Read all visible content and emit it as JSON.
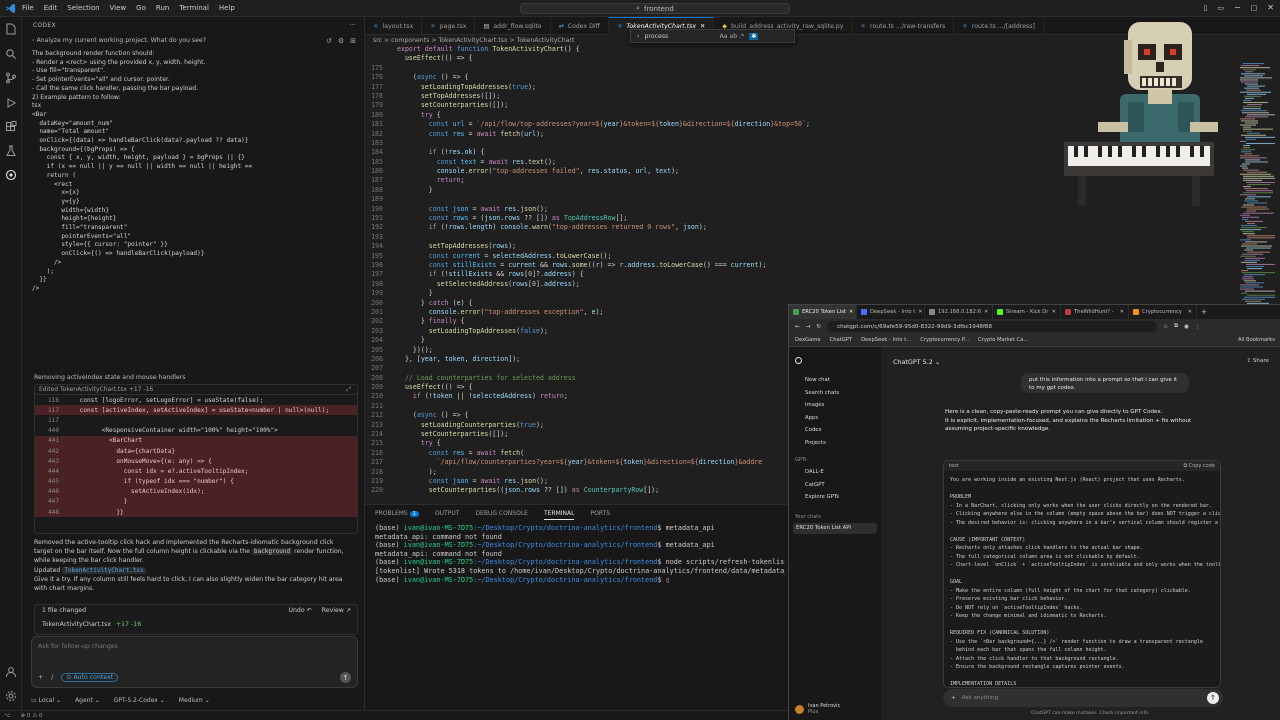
{
  "menu": [
    "File",
    "Edit",
    "Selection",
    "View",
    "Go",
    "Run",
    "Terminal",
    "Help"
  ],
  "command_center": "frontend",
  "codex": {
    "title": "CODEX",
    "prompt_header": "Analyze my current working project. What do you see?",
    "msg_lines": [
      "The background render function should:",
      "- Render a <rect> using the provided x, y, width, height.",
      "- Use fill=\"transparent\".",
      "- Set pointerEvents=\"all\" and cursor: pointer.",
      "- Call the same click handler, passing the bar payload.",
      "",
      "2) Example pattern to follow:",
      "tsx",
      "<Bar",
      "  dataKey=\"amount_num\"",
      "  name=\"Total amount\"",
      "  onClick={(data) => handleBarClick(data?.payload ?? data)}",
      "  background={(bgProps) => {",
      "    const { x, y, width, height, payload } = bgProps || {}",
      "    if (x == null || y == null || width == null || height ==",
      "",
      "    return (",
      "      <rect",
      "        x={x}",
      "        y={y}",
      "        width={width}",
      "        height={height}",
      "        fill=\"transparent\"",
      "        pointerEvents=\"all\"",
      "        style={{ cursor: \"pointer\" }}",
      "        onClick={() => handleBarClick(payload)}",
      "      />",
      "    );",
      "  }}",
      "/>"
    ],
    "removing": "Removing activeIndex state and mouse handlers",
    "diff_header": "Edited TokenActivityChart.tsx +17 -16",
    "diff": [
      {
        "n": "116",
        "t": "    const [logoError, setLogoError] = useState(false);",
        "k": "ctx"
      },
      {
        "n": "117",
        "t": "    const [activeIndex, setActiveIndex] = useState<number | null>(null);",
        "k": "del"
      },
      {
        "n": "117",
        "t": "",
        "k": "ctx"
      },
      {
        "n": "440",
        "t": "          <ResponsiveContainer width=\"100%\" height=\"100%\">",
        "k": "ctx"
      },
      {
        "n": "441",
        "t": "            <BarChart",
        "k": "del"
      },
      {
        "n": "442",
        "t": "              data={chartData}",
        "k": "del"
      },
      {
        "n": "443",
        "t": "              onMouseMove={(e: any) => {",
        "k": "del"
      },
      {
        "n": "444",
        "t": "                const idx = e?.activeTooltipIndex;",
        "k": "del"
      },
      {
        "n": "445",
        "t": "                if (typeof idx === \"number\") {",
        "k": "del"
      },
      {
        "n": "446",
        "t": "                  setActiveIndex(idx);",
        "k": "del"
      },
      {
        "n": "447",
        "t": "                }",
        "k": "del"
      },
      {
        "n": "448",
        "t": "              }}",
        "k": "del"
      },
      {
        "n": "",
        "t": "",
        "k": "ctx"
      }
    ],
    "summary_1": "Removed the active-tooltip click hack and implemented the Recharts-idiomatic background click target on the bar itself. Now the full column height is clickable via the",
    "summary_code": "background",
    "summary_2": "render function, while keeping the bar click handler.",
    "summary_updated": "Updated",
    "summary_file": "TokenActivityChart.tsx",
    "summary_3": "Give it a try. If any column still feels hard to click, I can also slightly widen the bar category hit area with chart margins.",
    "files_changed": "1 file changed",
    "undo": "Undo",
    "review": "Review",
    "changed_file": "TokenActivityChart.tsx",
    "changed_stats": "+17 -16",
    "followup_placeholder": "Ask for follow-up changes",
    "auto_context": "Auto context",
    "footer": [
      "Local",
      "Agent",
      "GPT-5.2-Codex",
      "Medium"
    ]
  },
  "editor": {
    "tabs": [
      "layout.tsx",
      "page.tsx",
      "addr_flow.sqlite",
      "Codex Diff",
      "TokenActivityChart.tsx",
      "build_address_activity_raw_sqlite.py",
      "route.ts .../raw-transfers",
      "route.ts .../[address]"
    ],
    "active_tab": 4,
    "breadcrumb": "src > components > TokenActivityChart.tsx > TokenActivityChart",
    "find_value": "process",
    "find_opts": "Aa  ab  .*"
  },
  "code_lines": [
    {
      "n": "",
      "h": "<span class=\"kw\">export default</span> <span class=\"kb\">function</span> <span class=\"fn\">TokenActivityChart</span>() {"
    },
    {
      "n": "",
      "h": "  <span class=\"fn\">useEffect</span>(() =&gt; {"
    },
    {
      "n": "175",
      "h": ""
    },
    {
      "n": "176",
      "h": "    (<span class=\"kb\">async</span> () =&gt; {"
    },
    {
      "n": "177",
      "h": "      <span class=\"fn\">setLoadingTopAddresses</span>(<span class=\"kb\">true</span>);"
    },
    {
      "n": "178",
      "h": "      <span class=\"fn\">setTopAddresses</span>([]);"
    },
    {
      "n": "179",
      "h": "      <span class=\"fn\">setCounterparties</span>([]);"
    },
    {
      "n": "180",
      "h": "      <span class=\"kw\">try</span> {"
    },
    {
      "n": "181",
      "h": "        <span class=\"kb\">const</span> <span class=\"bl\">url</span> = <span class=\"st\">`/api/flow/top-addresses?year=${</span><span class=\"vr\">year</span><span class=\"st\">}&amp;token=${</span><span class=\"vr\">token</span><span class=\"st\">}&amp;direction=${</span><span class=\"vr\">direction</span><span class=\"st\">}&amp;top=50`</span>;"
    },
    {
      "n": "182",
      "h": "        <span class=\"kb\">const</span> <span class=\"bl\">res</span> = <span class=\"kw\">await</span> <span class=\"fn\">fetch</span>(<span class=\"vr\">url</span>);"
    },
    {
      "n": "183",
      "h": ""
    },
    {
      "n": "184",
      "h": "        <span class=\"kw\">if</span> (!<span class=\"vr\">res</span>.<span class=\"vr\">ok</span>) {"
    },
    {
      "n": "185",
      "h": "          <span class=\"kb\">const</span> <span class=\"bl\">text</span> = <span class=\"kw\">await</span> <span class=\"vr\">res</span>.<span class=\"fn\">text</span>();"
    },
    {
      "n": "186",
      "h": "          <span class=\"vr\">console</span>.<span class=\"fn\">error</span>(<span class=\"st\">\"top-addresses failed\"</span>, <span class=\"vr\">res</span>.<span class=\"vr\">status</span>, <span class=\"vr\">url</span>, <span class=\"vr\">text</span>);"
    },
    {
      "n": "187",
      "h": "          <span class=\"kw\">return</span>;"
    },
    {
      "n": "188",
      "h": "        }"
    },
    {
      "n": "189",
      "h": ""
    },
    {
      "n": "190",
      "h": "        <span class=\"kb\">const</span> <span class=\"bl\">json</span> = <span class=\"kw\">await</span> <span class=\"vr\">res</span>.<span class=\"fn\">json</span>();"
    },
    {
      "n": "191",
      "h": "        <span class=\"kb\">const</span> <span class=\"bl\">rows</span> = (<span class=\"vr\">json</span>.<span class=\"vr\">rows</span> ?? []) <span class=\"kw\">as</span> <span class=\"ty\">TopAddressRow</span>[];"
    },
    {
      "n": "192",
      "h": "        <span class=\"kw\">if</span> (!<span class=\"vr\">rows</span>.<span class=\"vr\">length</span>) <span class=\"vr\">console</span>.<span class=\"fn\">warn</span>(<span class=\"st\">\"top-addresses returned 0 rows\"</span>, <span class=\"vr\">json</span>);"
    },
    {
      "n": "193",
      "h": ""
    },
    {
      "n": "194",
      "h": "        <span class=\"fn\">setTopAddresses</span>(<span class=\"vr\">rows</span>);"
    },
    {
      "n": "195",
      "h": "        <span class=\"kb\">const</span> <span class=\"bl\">current</span> = <span class=\"vr\">selectedAddress</span>.<span class=\"fn\">toLowerCase</span>();"
    },
    {
      "n": "196",
      "h": "        <span class=\"kb\">const</span> <span class=\"bl\">stillExists</span> = <span class=\"vr\">current</span> &amp;&amp; <span class=\"vr\">rows</span>.<span class=\"fn\">some</span>((<span class=\"vr\">r</span>) =&gt; <span class=\"vr\">r</span>.<span class=\"vr\">address</span>.<span class=\"fn\">toLowerCase</span>() === <span class=\"vr\">current</span>);"
    },
    {
      "n": "197",
      "h": "        <span class=\"kw\">if</span> (!<span class=\"vr\">stillExists</span> &amp;&amp; <span class=\"vr\">rows</span>[<span class=\"nm\">0</span>]?.<span class=\"vr\">address</span>) {"
    },
    {
      "n": "198",
      "h": "          <span class=\"fn\">setSelectedAddress</span>(<span class=\"vr\">rows</span>[<span class=\"nm\">0</span>].<span class=\"vr\">address</span>);"
    },
    {
      "n": "199",
      "h": "        }"
    },
    {
      "n": "200",
      "h": "      } <span class=\"kw\">catch</span> (<span class=\"vr\">e</span>) {"
    },
    {
      "n": "201",
      "h": "        <span class=\"vr\">console</span>.<span class=\"fn\">error</span>(<span class=\"st\">\"top-addresses exception\"</span>, <span class=\"vr\">e</span>);"
    },
    {
      "n": "202",
      "h": "      } <span class=\"kw\">finally</span> {"
    },
    {
      "n": "203",
      "h": "        <span class=\"fn\">setLoadingTopAddresses</span>(<span class=\"kb\">false</span>);"
    },
    {
      "n": "204",
      "h": "      }"
    },
    {
      "n": "205",
      "h": "    })();"
    },
    {
      "n": "206",
      "h": "  }, [<span class=\"vr\">year</span>, <span class=\"vr\">token</span>, <span class=\"vr\">direction</span>]);"
    },
    {
      "n": "207",
      "h": ""
    },
    {
      "n": "208",
      "h": "  <span class=\"cm\">// Load counterparties for selected address</span>"
    },
    {
      "n": "209",
      "h": "  <span class=\"fn\">useEffect</span>(() =&gt; {"
    },
    {
      "n": "210",
      "h": "    <span class=\"kw\">if</span> (!<span class=\"vr\">token</span> || !<span class=\"vr\">selectedAddress</span>) <span class=\"kw\">return</span>;"
    },
    {
      "n": "211",
      "h": ""
    },
    {
      "n": "212",
      "h": "    (<span class=\"kb\">async</span> () =&gt; {"
    },
    {
      "n": "213",
      "h": "      <span class=\"fn\">setLoadingCounterparties</span>(<span class=\"kb\">true</span>);"
    },
    {
      "n": "214",
      "h": "      <span class=\"fn\">setCounterparties</span>([]);"
    },
    {
      "n": "215",
      "h": "      <span class=\"kw\">try</span> {"
    },
    {
      "n": "216",
      "h": "        <span class=\"kb\">const</span> <span class=\"bl\">res</span> = <span class=\"kw\">await</span> <span class=\"fn\">fetch</span>("
    },
    {
      "n": "217",
      "h": "          <span class=\"st\">`/api/flow/counterparties?year=${</span><span class=\"vr\">year</span><span class=\"st\">}&amp;token=${</span><span class=\"vr\">token</span><span class=\"st\">}&amp;direction=${</span><span class=\"vr\">direction</span><span class=\"st\">}&amp;addre</span>"
    },
    {
      "n": "218",
      "h": "        );"
    },
    {
      "n": "219",
      "h": "        <span class=\"kb\">const</span> <span class=\"bl\">json</span> = <span class=\"kw\">await</span> <span class=\"vr\">res</span>.<span class=\"fn\">json</span>();"
    },
    {
      "n": "220",
      "h": "        <span class=\"fn\">setCounterparties</span>((<span class=\"vr\">json</span>.<span class=\"vr\">rows</span> ?? []) <span class=\"kw\">as</span> <span class=\"ty\">CounterpartyRow</span>[]);"
    }
  ],
  "panel": {
    "tabs": [
      "PROBLEMS",
      "OUTPUT",
      "DEBUG CONSOLE",
      "TERMINAL",
      "PORTS"
    ],
    "problems_count": "1",
    "active": 3
  },
  "terminal": [
    {
      "p": "(base) ",
      "u": "ivan@ivan-MS-7D75",
      "path": ":~/Desktop/Crypto/doctrina-analytics/frontend",
      "c": "$ metadata_api"
    },
    {
      "p": "",
      "u": "",
      "path": "",
      "c": "metadata_api: command not found"
    },
    {
      "p": "(base) ",
      "u": "ivan@ivan-MS-7D75",
      "path": ":~/Desktop/Crypto/doctrina-analytics/frontend",
      "c": "$ metadata_api"
    },
    {
      "p": "",
      "u": "",
      "path": "",
      "c": "metadata_api: command not found"
    },
    {
      "p": "(base) ",
      "u": "ivan@ivan-MS-7D75",
      "path": ":~/Desktop/Crypto/doctrina-analytics/frontend",
      "c": "$ node scripts/refresh-tokenlist.m"
    },
    {
      "p": "",
      "u": "",
      "path": "",
      "c": "[tokenlist] Wrote 5318 tokens to /home/ivan/Desktop/Crypto/doctrina-analytics/frontend/data/metadata_ap"
    },
    {
      "p": "(base) ",
      "u": "ivan@ivan-MS-7D75",
      "path": ":~/Desktop/Crypto/doctrina-analytics/frontend",
      "c": "$ "
    }
  ],
  "status": [
    "⊗ 0 ⚠ 0",
    "",
    ""
  ],
  "browser": {
    "tabs": [
      "ERC20 Token List",
      "DeepSeek - Into t",
      "192.168.0.182:6",
      "Stream - Kick Dr",
      "TheWildHunt? - ",
      "Cryptocurrency"
    ],
    "url": "chatgpt.com/c/69afe59-95d0-8322-99d9-3dfbc1948f88",
    "bookmarks": [
      "DexGame",
      "ChatGPT",
      "DeepSeek - Into t...",
      "Cryptocurrency P...",
      "Crypto Market Ca...",
      "All Bookmarks"
    ],
    "side_items": [
      "New chat",
      "Search chats",
      "Images",
      "Apps",
      "Codex",
      "Projects"
    ],
    "gpts_label": "GPTs",
    "gpts": [
      "DALL-E",
      "CatGPT",
      "Explore GPTs"
    ],
    "chats_label": "Your chats",
    "chats": [
      "ERC20 Token List API"
    ],
    "user": "Ivan Petrovic",
    "user_plan": "Plus",
    "model": "ChatGPT 5.2 ⌄",
    "share": "⇪ Share",
    "user_msg": "put this information into a prompt so that i can give it to my gpt codex.",
    "assist_1": "Here is a clean, copy-paste-ready prompt you can give directly to GPT Codex.",
    "assist_2": "It is explicit, implementation-focused, and explains the Recharts limitation + fix without assuming project-specific knowledge.",
    "code_label": "text",
    "copy_label": "⧉ Copy code",
    "prompt_body": "You are working inside an existing Next.js (React) project that uses Recharts.\n\nPROBLEM\n- In a BarChart, clicking only works when the user clicks directly on the rendered bar.\n- Clicking anywhere else in the column (empty space above the bar) does NOT trigger a clic\n- The desired behavior is: clicking anywhere in a bar's vertical column should register a\n\nCAUSE (IMPORTANT CONTEXT)\n- Recharts only attaches click handlers to the actual bar shape.\n- The full categorical column area is not clickable by default.\n- Chart-level `onClick` + `activeTooltipIndex` is unreliable and only works when the toolti\n\nGOAL\n- Make the entire column (full height of the chart for that category) clickable.\n- Preserve existing bar click behavior.\n- Do NOT rely on `activeTooltipIndex` hacks.\n- Keep the change minimal and idiomatic to Recharts.\n\nREQUIRED FIX (CANONICAL SOLUTION)\n- Use the `<Bar background={...} />` render function to draw a transparent rectangle\n  behind each bar that spans the full column height.\n- Attach the click handler to that background rectangle.\n- Ensure the background rectangle captures pointer events.\n\nIMPLEMENTATION DETAILS",
    "ask_placeholder": "Ask anything",
    "disclaimer": "ChatGPT can make mistakes. Check important info."
  }
}
